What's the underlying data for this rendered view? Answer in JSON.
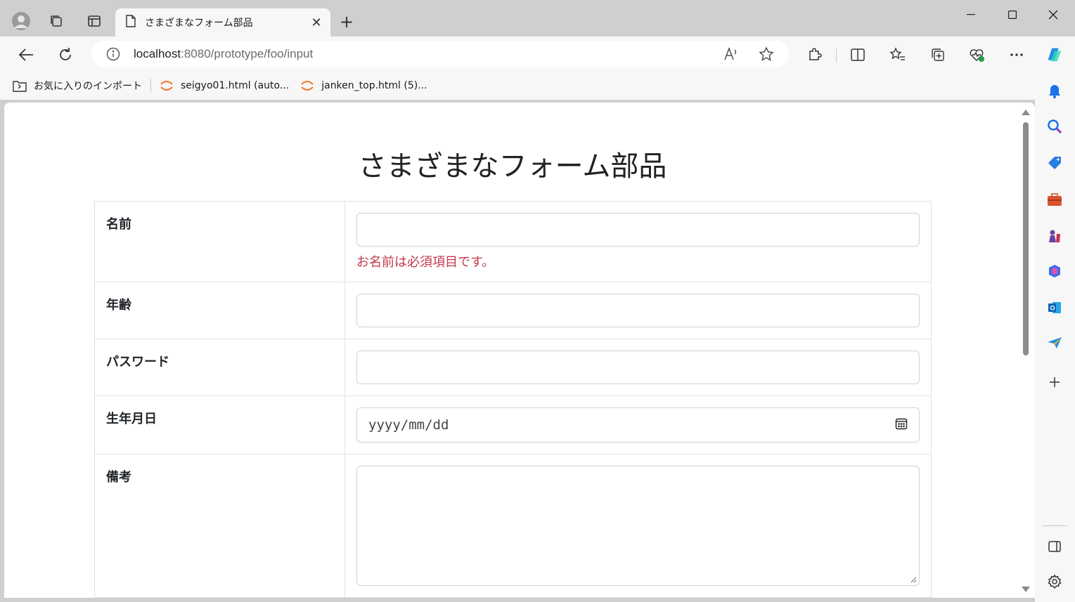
{
  "browser": {
    "tab_title": "さまざまなフォーム部品",
    "url_host": "localhost",
    "url_path": ":8080/prototype/foo/input",
    "bookmarks": [
      {
        "label": "お気に入りのインポート"
      },
      {
        "label": "seigyo01.html (auto..."
      },
      {
        "label": "janken_top.html (5)..."
      }
    ],
    "accent": "#0a64d8"
  },
  "page": {
    "title": "さまざまなフォーム部品",
    "rows": [
      {
        "label": "名前",
        "error": "お名前は必須項目です。"
      },
      {
        "label": "年齢"
      },
      {
        "label": "パスワード"
      },
      {
        "label": "生年月日",
        "placeholder": "yyyy/mm/dd"
      },
      {
        "label": "備考"
      }
    ],
    "error_color": "#c4364a"
  }
}
